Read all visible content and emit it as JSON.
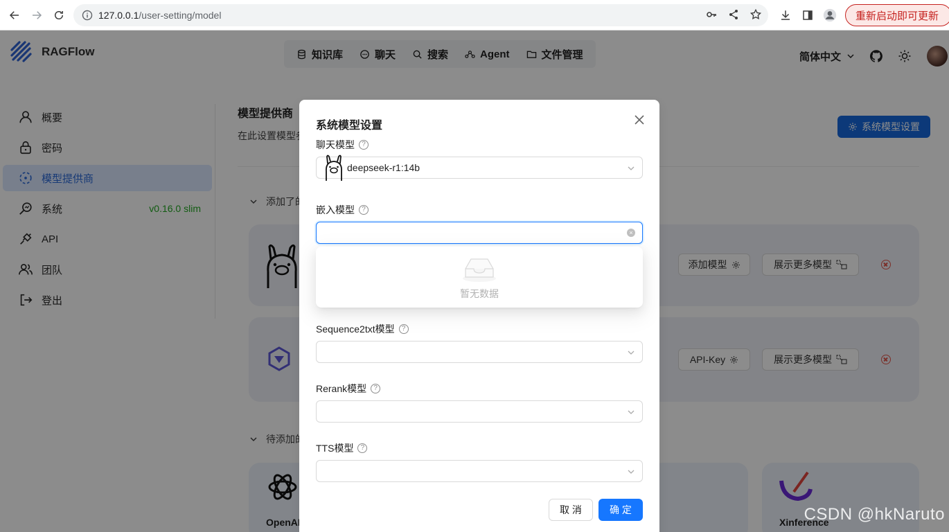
{
  "browser": {
    "url_host": "127.0.0.1",
    "url_path": "/user-setting/model",
    "update_button": "重新启动即可更新"
  },
  "app": {
    "name": "RAGFlow",
    "nav": [
      {
        "label": "知识库",
        "icon": "database-icon"
      },
      {
        "label": "聊天",
        "icon": "chat-icon"
      },
      {
        "label": "搜索",
        "icon": "search-icon"
      },
      {
        "label": "Agent",
        "icon": "agent-icon"
      },
      {
        "label": "文件管理",
        "icon": "folder-icon"
      }
    ],
    "language": "简体中文"
  },
  "sidebar": {
    "items": [
      {
        "label": "概要",
        "icon": "user-icon"
      },
      {
        "label": "密码",
        "icon": "lock-icon"
      },
      {
        "label": "模型提供商",
        "icon": "model-icon",
        "active": true
      },
      {
        "label": "系统",
        "icon": "system-icon"
      },
      {
        "label": "API",
        "icon": "api-icon"
      },
      {
        "label": "团队",
        "icon": "team-icon"
      },
      {
        "label": "登出",
        "icon": "logout-icon"
      }
    ],
    "version": "v0.16.0 slim"
  },
  "main": {
    "title": "模型提供商",
    "description": "在此设置模型参",
    "system_button": "系统模型设置",
    "added_section": "添加了的",
    "pending_section": "待添加的",
    "cards": [
      {
        "buttons": [
          "添加模型",
          "展示更多模型"
        ]
      },
      {
        "buttons": [
          "API-Key",
          "展示更多模型"
        ]
      }
    ],
    "pending": [
      "OpenAI",
      "Xinference"
    ]
  },
  "modal": {
    "title": "系统模型设置",
    "fields": [
      {
        "label": "聊天模型",
        "value": "deepseek-r1:14b"
      },
      {
        "label": "嵌入模型",
        "value": ""
      },
      {
        "label": "Sequence2txt模型",
        "value": ""
      },
      {
        "label": "Rerank模型",
        "value": ""
      },
      {
        "label": "TTS模型",
        "value": ""
      }
    ],
    "empty_text": "暂无数据",
    "cancel": "取 消",
    "ok": "确 定"
  },
  "watermark": "CSDN @hkNaruto",
  "colors": {
    "primary": "#1677ff",
    "version_green": "#22a822",
    "danger": "#e2554a"
  }
}
